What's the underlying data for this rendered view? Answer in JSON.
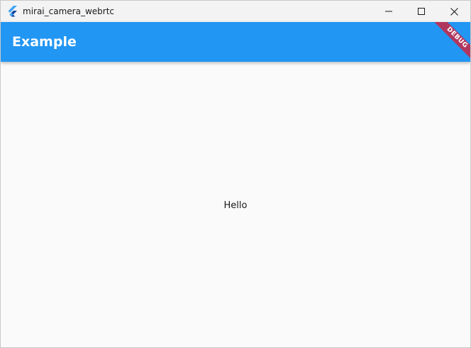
{
  "window": {
    "title": "mirai_camera_webrtc",
    "controls": {
      "minimize_icon": "minimize-icon",
      "maximize_icon": "maximize-icon",
      "close_icon": "close-icon"
    },
    "app_icon": "flutter-icon"
  },
  "appbar": {
    "title": "Example",
    "color": "#2196f3"
  },
  "debug_banner": {
    "label": "DEBUG",
    "color": "#b0365d"
  },
  "body": {
    "text": "Hello"
  }
}
